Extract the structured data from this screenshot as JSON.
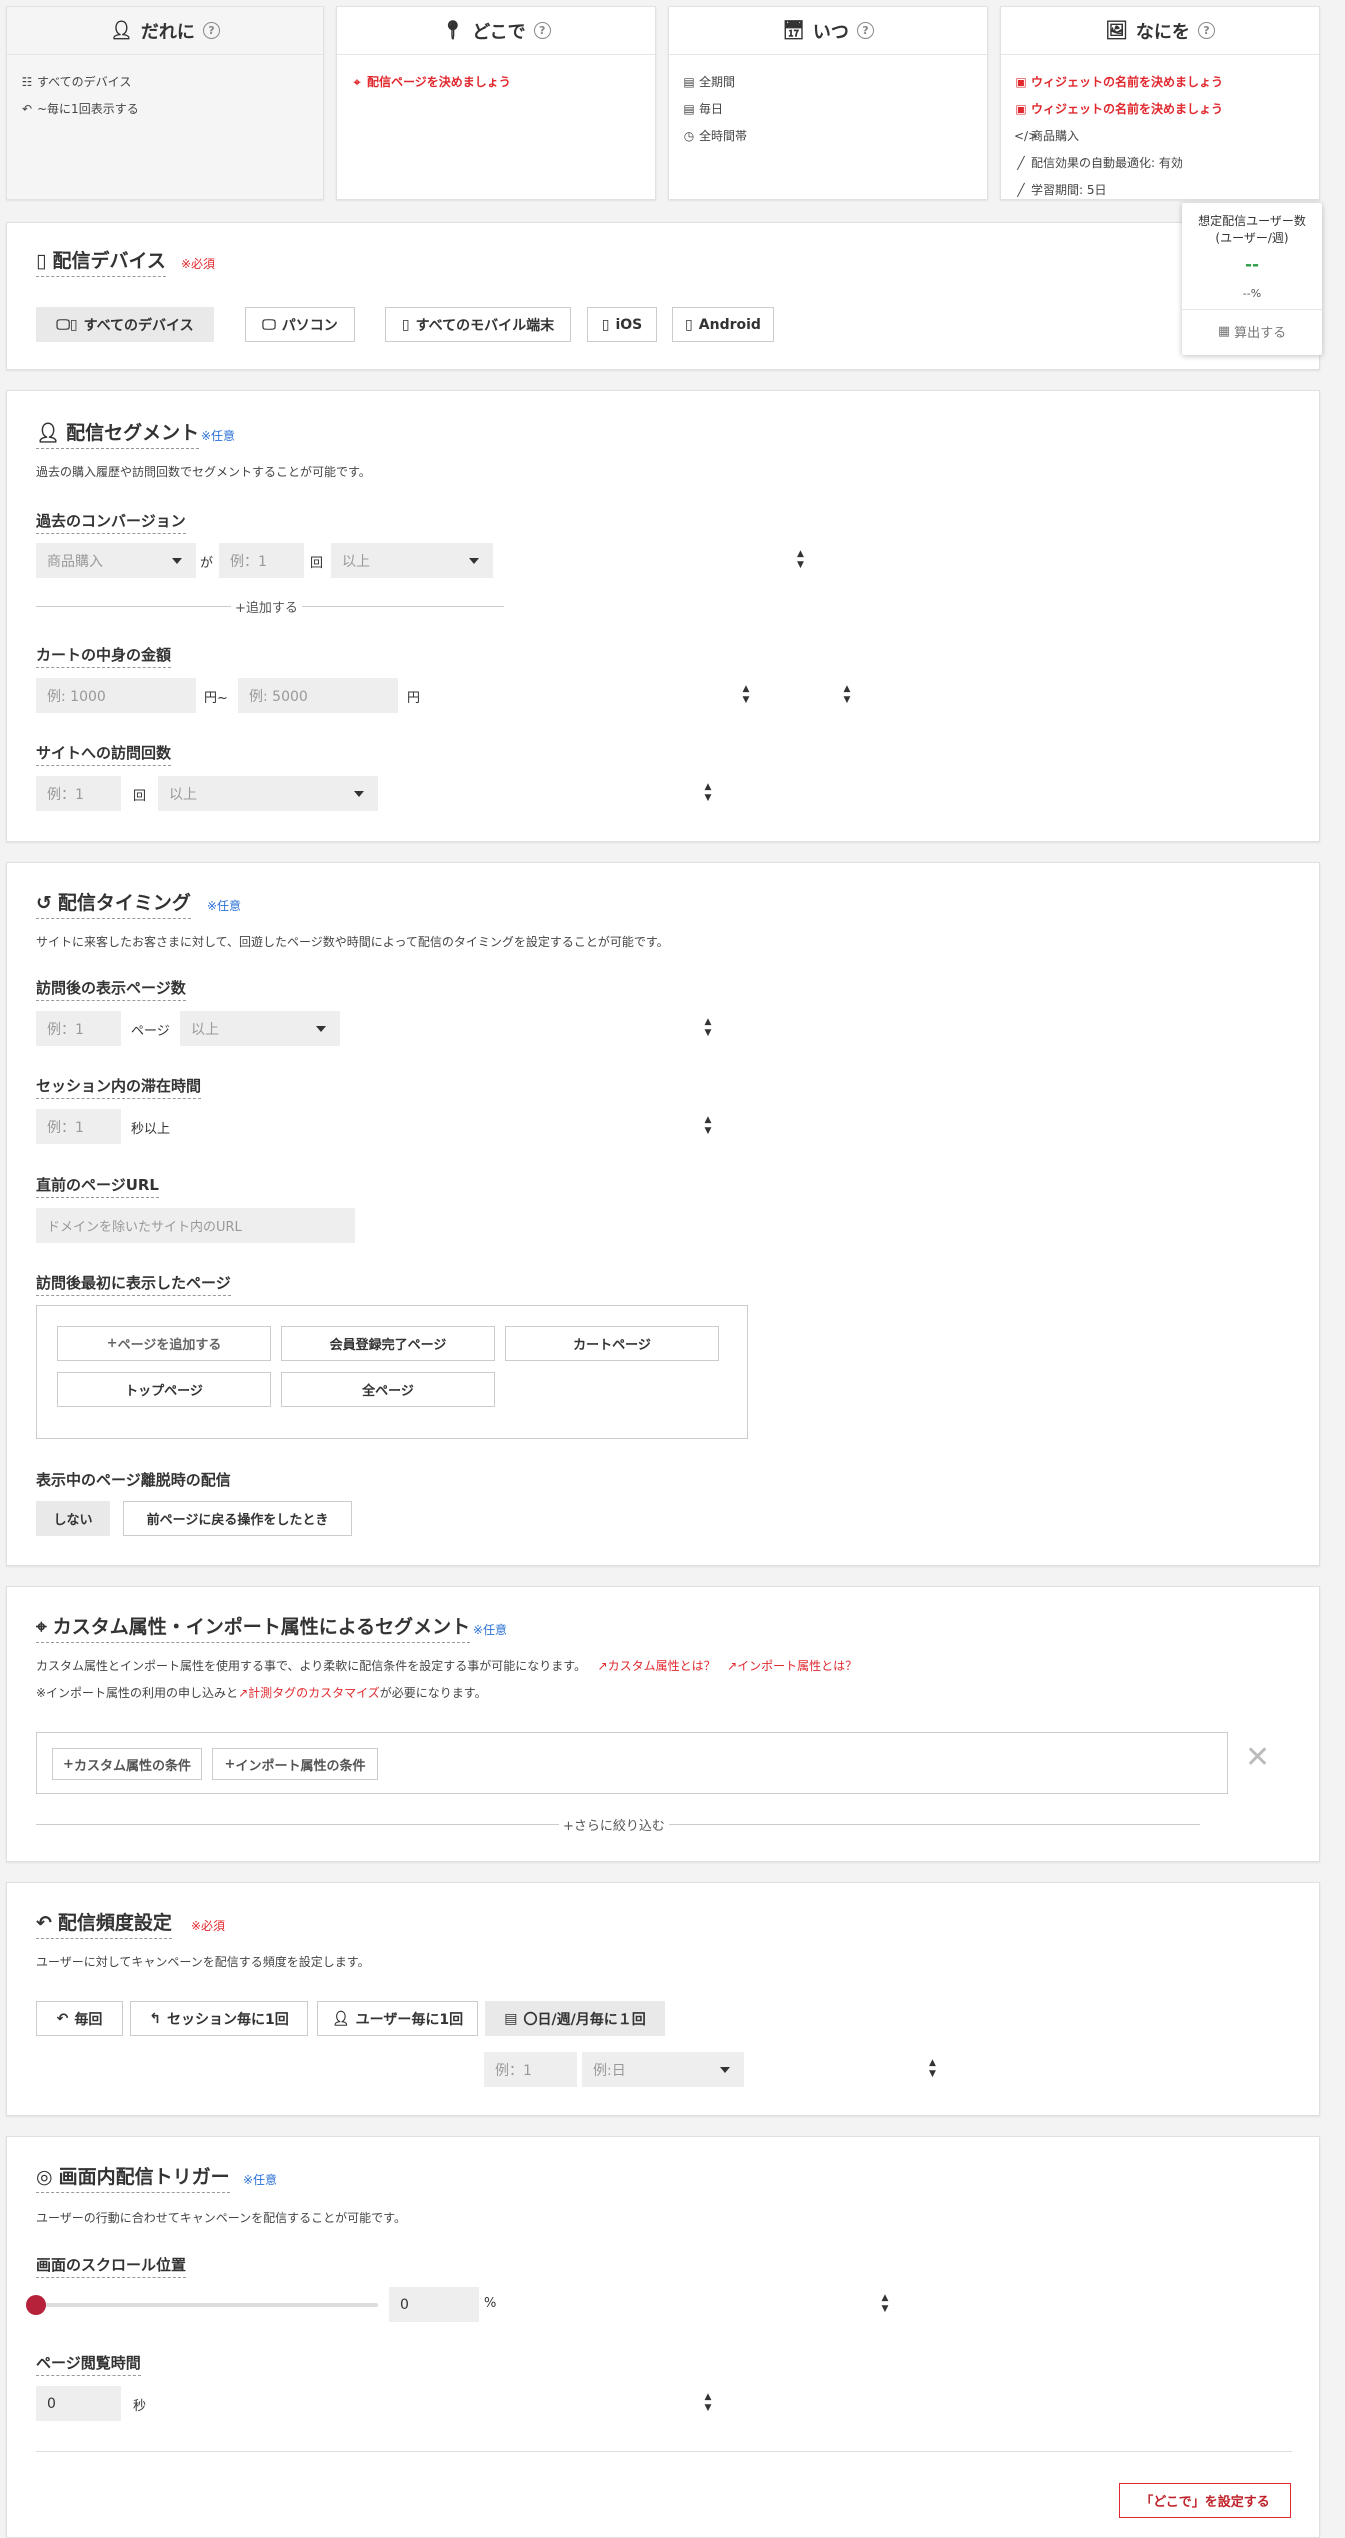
{
  "summary": {
    "who": {
      "title": "だれに",
      "items": [
        "すべてのデバイス",
        "~毎に1回表示する"
      ]
    },
    "where": {
      "title": "どこで",
      "items": [
        "配信ページを決めましょう"
      ]
    },
    "when": {
      "title": "いつ",
      "items": [
        "全期間",
        "毎日",
        "全時間帯"
      ]
    },
    "what": {
      "title": "なにを",
      "items": [
        "ウィジェットの名前を決めましょう",
        "ウィジェットの名前を決めましょう",
        "商品購入",
        "配信効果の自動最適化: 有効",
        "学習期間: 5日"
      ]
    }
  },
  "estimate": {
    "title": "想定配信ユーザー数\n(ユーザー/週)",
    "value": "--",
    "percent": "--%",
    "calc_button": "算出する"
  },
  "device": {
    "title": "配信デバイス",
    "tag": "※必須",
    "buttons": [
      "すべてのデバイス",
      "パソコン",
      "すべてのモバイル端末",
      "iOS",
      "Android"
    ]
  },
  "segment": {
    "title": "配信セグメント",
    "tag": "※任意",
    "description": "過去の購入履歴や訪問回数でセグメントすることが可能です。",
    "conversion_label": "過去のコンバージョン",
    "conversion_select": "商品購入",
    "ga": "が",
    "count_placeholder": "例：1",
    "kai": "回",
    "compare_select": "以上",
    "add_link": "追加する",
    "cart_label": "カートの中身の金額",
    "cart_min_placeholder": "例: 1000",
    "yen_range": "円~",
    "cart_max_placeholder": "例: 5000",
    "yen": "円",
    "visits_label": "サイトへの訪問回数",
    "visits_placeholder": "例：1",
    "visits_kai": "回",
    "visits_select": "以上"
  },
  "timing": {
    "title": "配信タイミング",
    "tag": "※任意",
    "description": "サイトに来客したお客さまに対して、回遊したページ数や時間によって配信のタイミングを設定することが可能です。",
    "pages_label": "訪問後の表示ページ数",
    "pages_placeholder": "例：1",
    "pages_unit": "ページ",
    "pages_select": "以上",
    "session_label": "セッション内の滞在時間",
    "session_placeholder": "例：1",
    "session_unit": "秒以上",
    "prev_url_label": "直前のページURL",
    "prev_url_placeholder": "ドメインを除いたサイト内のURL",
    "first_page_label": "訪問後最初に表示したページ",
    "page_buttons": [
      "ページを追加する",
      "会員登録完了ページ",
      "カートページ",
      "トップページ",
      "全ページ"
    ],
    "exit_label": "表示中のページ離脱時の配信",
    "exit_buttons": [
      "しない",
      "前ページに戻る操作をしたとき"
    ]
  },
  "custom": {
    "title": "カスタム属性・インポート属性によるセグメント",
    "tag": "※任意",
    "description": "カスタム属性とインポート属性を使用する事で、より柔軟に配信条件を設定する事が可能になります。",
    "link_custom": "カスタム属性とは？",
    "link_import": "インポート属性とは？",
    "note_prefix": "※インポート属性の利用の申し込みと",
    "note_link": "計測タグのカスタマイズ",
    "note_suffix": "が必要になります。",
    "cond_custom": "カスタム属性の条件",
    "cond_import": "インポート属性の条件",
    "narrow": "さらに絞り込む"
  },
  "frequency": {
    "title": "配信頻度設定",
    "tag": "※必須",
    "description": "ユーザーに対してキャンペーンを配信する頻度を設定します。",
    "buttons": [
      "毎回",
      "セッション毎に1回",
      "ユーザー毎に1回",
      "〇日/週/月毎に１回"
    ],
    "count_placeholder": "例：1",
    "period_select": "例:日"
  },
  "trigger": {
    "title": "画面内配信トリガー",
    "tag": "※任意",
    "description": "ユーザーの行動に合わせてキャンペーンを配信することが可能です。",
    "scroll_label": "画面のスクロール位置",
    "scroll_value": "0",
    "scroll_unit": "%",
    "scroll_fraction": 0,
    "time_label": "ページ閲覧時間",
    "time_value": "0",
    "time_unit": "秒"
  },
  "footer": {
    "next_button": "「どこで」を設定する"
  },
  "colors": {
    "accent": "#e0282e",
    "optional": "#2a6fd6",
    "slider": "#b5223a"
  }
}
